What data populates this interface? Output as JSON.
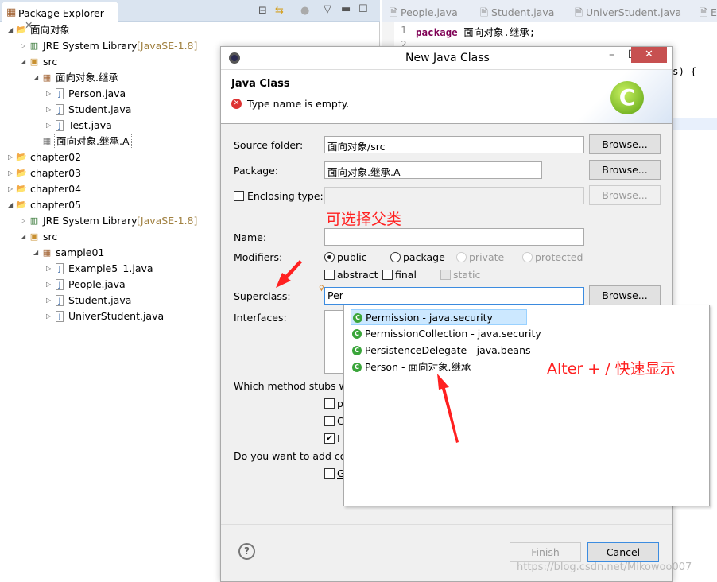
{
  "package_explorer": {
    "title": "Package Explorer",
    "tree": [
      {
        "label": "面向对象",
        "depth": 0,
        "state": "expanded",
        "icon": "project-icon"
      },
      {
        "label": "JRE System Library",
        "decoration": "[JavaSE-1.8]",
        "depth": 1,
        "state": "collapsed",
        "icon": "library-icon"
      },
      {
        "label": "src",
        "depth": 1,
        "state": "expanded",
        "icon": "source-folder-icon"
      },
      {
        "label": "面向对象.继承",
        "depth": 2,
        "state": "expanded",
        "icon": "package-icon"
      },
      {
        "label": "Person.java",
        "depth": 3,
        "state": "collapsed",
        "icon": "java-file-icon"
      },
      {
        "label": "Student.java",
        "depth": 3,
        "state": "collapsed",
        "icon": "java-file-icon"
      },
      {
        "label": "Test.java",
        "depth": 3,
        "state": "collapsed",
        "icon": "java-file-icon"
      },
      {
        "label": "面向对象.继承.A",
        "depth": 2,
        "state": "leaf",
        "icon": "empty-package-icon",
        "selected": true
      },
      {
        "label": "chapter02",
        "depth": 0,
        "state": "collapsed",
        "icon": "project-icon"
      },
      {
        "label": "chapter03",
        "depth": 0,
        "state": "collapsed",
        "icon": "project-icon"
      },
      {
        "label": "chapter04",
        "depth": 0,
        "state": "collapsed",
        "icon": "project-icon"
      },
      {
        "label": "chapter05",
        "depth": 0,
        "state": "expanded",
        "icon": "project-icon"
      },
      {
        "label": "JRE System Library",
        "decoration": "[JavaSE-1.8]",
        "depth": 1,
        "state": "collapsed",
        "icon": "library-icon"
      },
      {
        "label": "src",
        "depth": 1,
        "state": "expanded",
        "icon": "source-folder-icon"
      },
      {
        "label": "sample01",
        "depth": 2,
        "state": "expanded",
        "icon": "package-icon"
      },
      {
        "label": "Example5_1.java",
        "depth": 3,
        "state": "collapsed",
        "icon": "java-file-icon"
      },
      {
        "label": "People.java",
        "depth": 3,
        "state": "collapsed",
        "icon": "java-file-icon"
      },
      {
        "label": "Student.java",
        "depth": 3,
        "state": "collapsed",
        "icon": "java-file-icon"
      },
      {
        "label": "UniverStudent.java",
        "depth": 3,
        "state": "collapsed",
        "icon": "java-file-icon"
      }
    ]
  },
  "editor": {
    "tabs": [
      "People.java",
      "Student.java",
      "UniverStudent.java",
      "E"
    ],
    "line1_no": "1",
    "line2_no": "2",
    "keyword": "package",
    "code_rest": " 面向对象.继承;",
    "fragment": "s)  {"
  },
  "dialog": {
    "title": "New Java Class",
    "header_title": "Java Class",
    "error": "Type name is empty.",
    "source_folder_label": "Source folder:",
    "source_folder_value": "面向对象/src",
    "package_label": "Package:",
    "package_value": "面向对象.继承.A",
    "enclosing_label": "Enclosing type:",
    "browse": "Browse...",
    "name_label": "Name:",
    "name_value": "",
    "modifiers_label": "Modifiers:",
    "modifiers": {
      "public": "public",
      "package": "package",
      "private": "private",
      "protected": "protected",
      "abstract": "abstract",
      "final": "final",
      "static": "static"
    },
    "superclass_label": "Superclass:",
    "superclass_value": "Per",
    "interfaces_label": "Interfaces:",
    "stubs_label": "Which method stubs wo",
    "stub_options": [
      "p",
      "C",
      "I"
    ],
    "comments_label": "Do you want to add co",
    "comments_option": "G",
    "finish": "Finish",
    "cancel": "Cancel"
  },
  "autocomplete": {
    "items": [
      "Permission - java.security",
      "PermissionCollection - java.security",
      "PersistenceDelegate - java.beans",
      "Person - 面向对象.继承"
    ]
  },
  "annotations": {
    "choose_parent": "可选择父类",
    "shortcut": "Alter + /  快速显示"
  },
  "watermark": "https://blog.csdn.net/Mikowoo007",
  "colors": {
    "annotation": "#ff2020",
    "close": "#c75050",
    "keyword": "#7f0055",
    "highlight": "#cce8ff"
  }
}
